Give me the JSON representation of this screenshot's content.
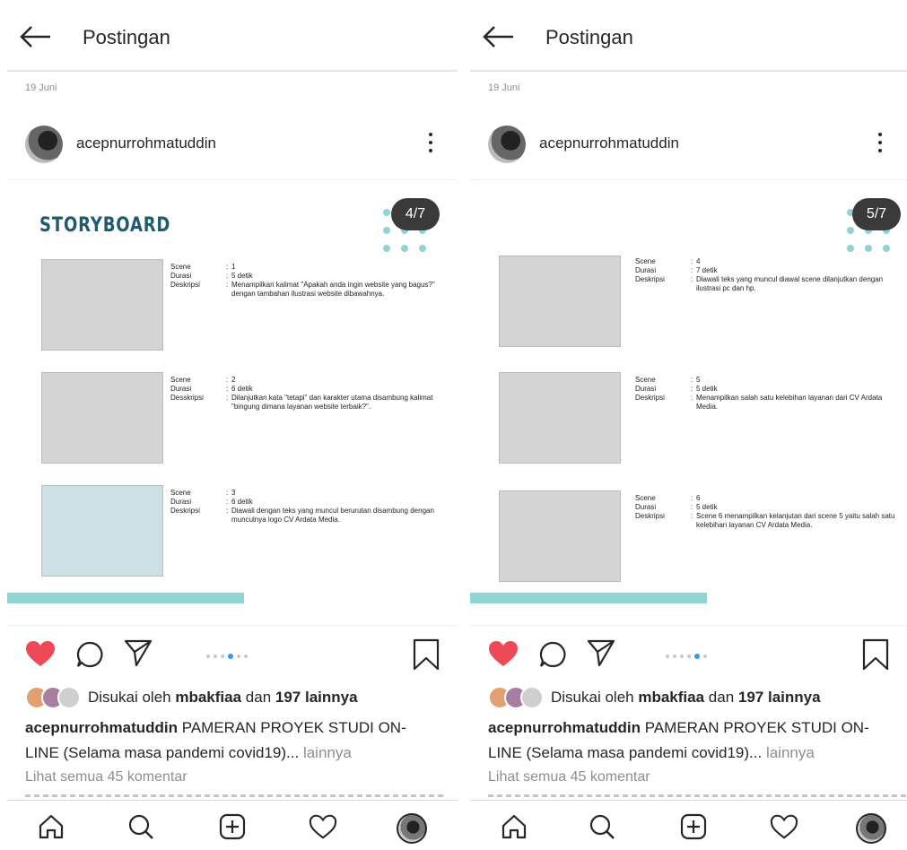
{
  "panels": [
    {
      "appbar": {
        "title": "Postingan"
      },
      "date": "19 Juni",
      "post": {
        "username": "acepnurrohmatuddin",
        "counter": "4/7"
      },
      "storyboard_title": "STORYBOARD",
      "scenes": [
        {
          "k1": "Scene",
          "k2": "Durasi",
          "k3": "Deskripsi",
          "v1": "1",
          "v2": "5 detik",
          "v3": "Menampilkan kalimat \"Apakah anda ingin website yang bagus?\" dengan tambahan ilustrasi website dibawahnya."
        },
        {
          "k1": "Scene",
          "k2": "Durasi",
          "k3": "Desskripsi",
          "v1": "2",
          "v2": "6 detik",
          "v3": "Dilanjutkan kata \"tetapi\" dan karakter utama disambung kalimat \"bingung dimana layanan website terbaik?\"."
        },
        {
          "k1": "Scene",
          "k2": "Durasi",
          "k3": "Deskripsi",
          "v1": "3",
          "v2": "6 detik",
          "v3": "Diawali dengan teks yang muncul berurutan disambung dengan munculnya logo CV Ardata Media."
        }
      ],
      "likes": {
        "prefix": "Disukai oleh",
        "user": "mbakfiaa",
        "mid": "dan",
        "others": "197 lainnya"
      },
      "caption": {
        "user": "acepnurrohmatuddin",
        "text": "PAMERAN PROYEK STUDI ON-LINE (Selama masa pandemi covid19)...",
        "more": "lainnya"
      },
      "comments_link": "Lihat semua 45 komentar"
    },
    {
      "appbar": {
        "title": "Postingan"
      },
      "date": "19 Juni",
      "post": {
        "username": "acepnurrohmatuddin",
        "counter": "5/7"
      },
      "scenes": [
        {
          "k1": "Scene",
          "k2": "Durasi",
          "k3": "Deskripsi",
          "v1": "4",
          "v2": "7 detik",
          "v3": "Diawali teks yang muncul diawal scene dilanjutkan dengan ilustrasi pc dan hp."
        },
        {
          "k1": "Scene",
          "k2": "Durasi",
          "k3": "Deskripsi",
          "v1": "5",
          "v2": "5 detik",
          "v3": "Menampilkan salah satu kelebihan layanan dari CV Ardata Media."
        },
        {
          "k1": "Scene",
          "k2": "Durasi",
          "k3": "Deskripsi",
          "v1": "6",
          "v2": "5 detik",
          "v3": "Scene 6 menampilkan kelanjutan dari scene 5 yaitu salah satu kelebihan layanan CV Ardata Media."
        }
      ],
      "likes": {
        "prefix": "Disukai oleh",
        "user": "mbakfiaa",
        "mid": "dan",
        "others": "197 lainnya"
      },
      "caption": {
        "user": "acepnurrohmatuddin",
        "text": "PAMERAN PROYEK STUDI ON-LINE (Selama masa pandemi covid19)...",
        "more": "lainnya"
      },
      "comments_link": "Lihat semua 45 komentar"
    }
  ],
  "colors": {
    "like": "#ed4956",
    "teal": "#8fd3d3",
    "storyboard": "#1f5b6c",
    "active_dot": "#3897f0"
  },
  "icons": [
    "back-arrow-icon",
    "more-options-icon",
    "heart-icon",
    "comment-icon",
    "share-icon",
    "bookmark-icon",
    "home-icon",
    "search-icon",
    "add-post-icon",
    "activity-heart-icon",
    "profile-avatar"
  ]
}
